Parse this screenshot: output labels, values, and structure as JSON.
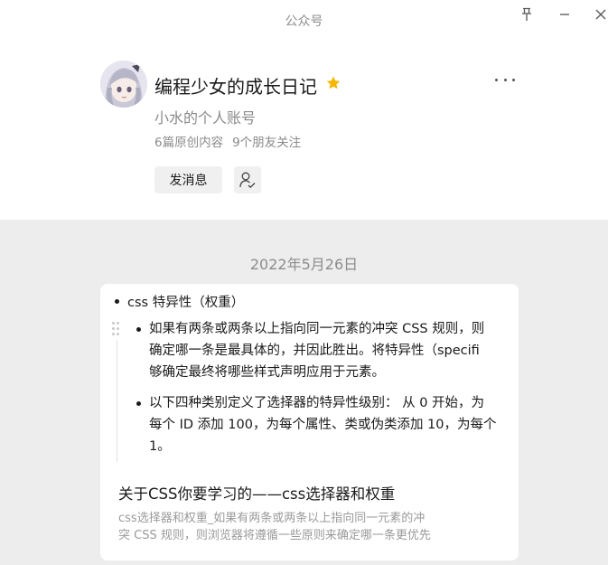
{
  "window": {
    "title": "公众号"
  },
  "profile": {
    "name": "编程少女的成长日记",
    "subtitle": "小水的个人账号",
    "original_count": "6篇原创内容",
    "friends_follow": "9个朋友关注",
    "message_button": "发消息",
    "star_color": "#f7b500"
  },
  "feed": {
    "date": "2022年5月26日",
    "preview": {
      "top_bullet": "css 特异性（权重）",
      "items": [
        {
          "lines": [
            "如果有两条或两条以上指向同一元素的冲突 CSS 规则，则",
            "确定哪一条是最具体的，并因此胜出。将特异性（specifi",
            "够确定最终将哪些样式声明应用于元素。"
          ]
        },
        {
          "lines": [
            "以下四种类别定义了选择器的特异性级别： 从 0 开始，为",
            "每个 ID 添加 100，为每个属性、类或伪类添加 10，为每个",
            "1。"
          ]
        }
      ]
    },
    "article": {
      "title": "关于CSS你要学习的——css选择器和权重",
      "desc_line1": "css选择器和权重_如果有两条或两条以上指向同一元素的冲",
      "desc_line2": "突 CSS 规则，则浏览器将遵循一些原则来确定哪一条更优先"
    }
  }
}
